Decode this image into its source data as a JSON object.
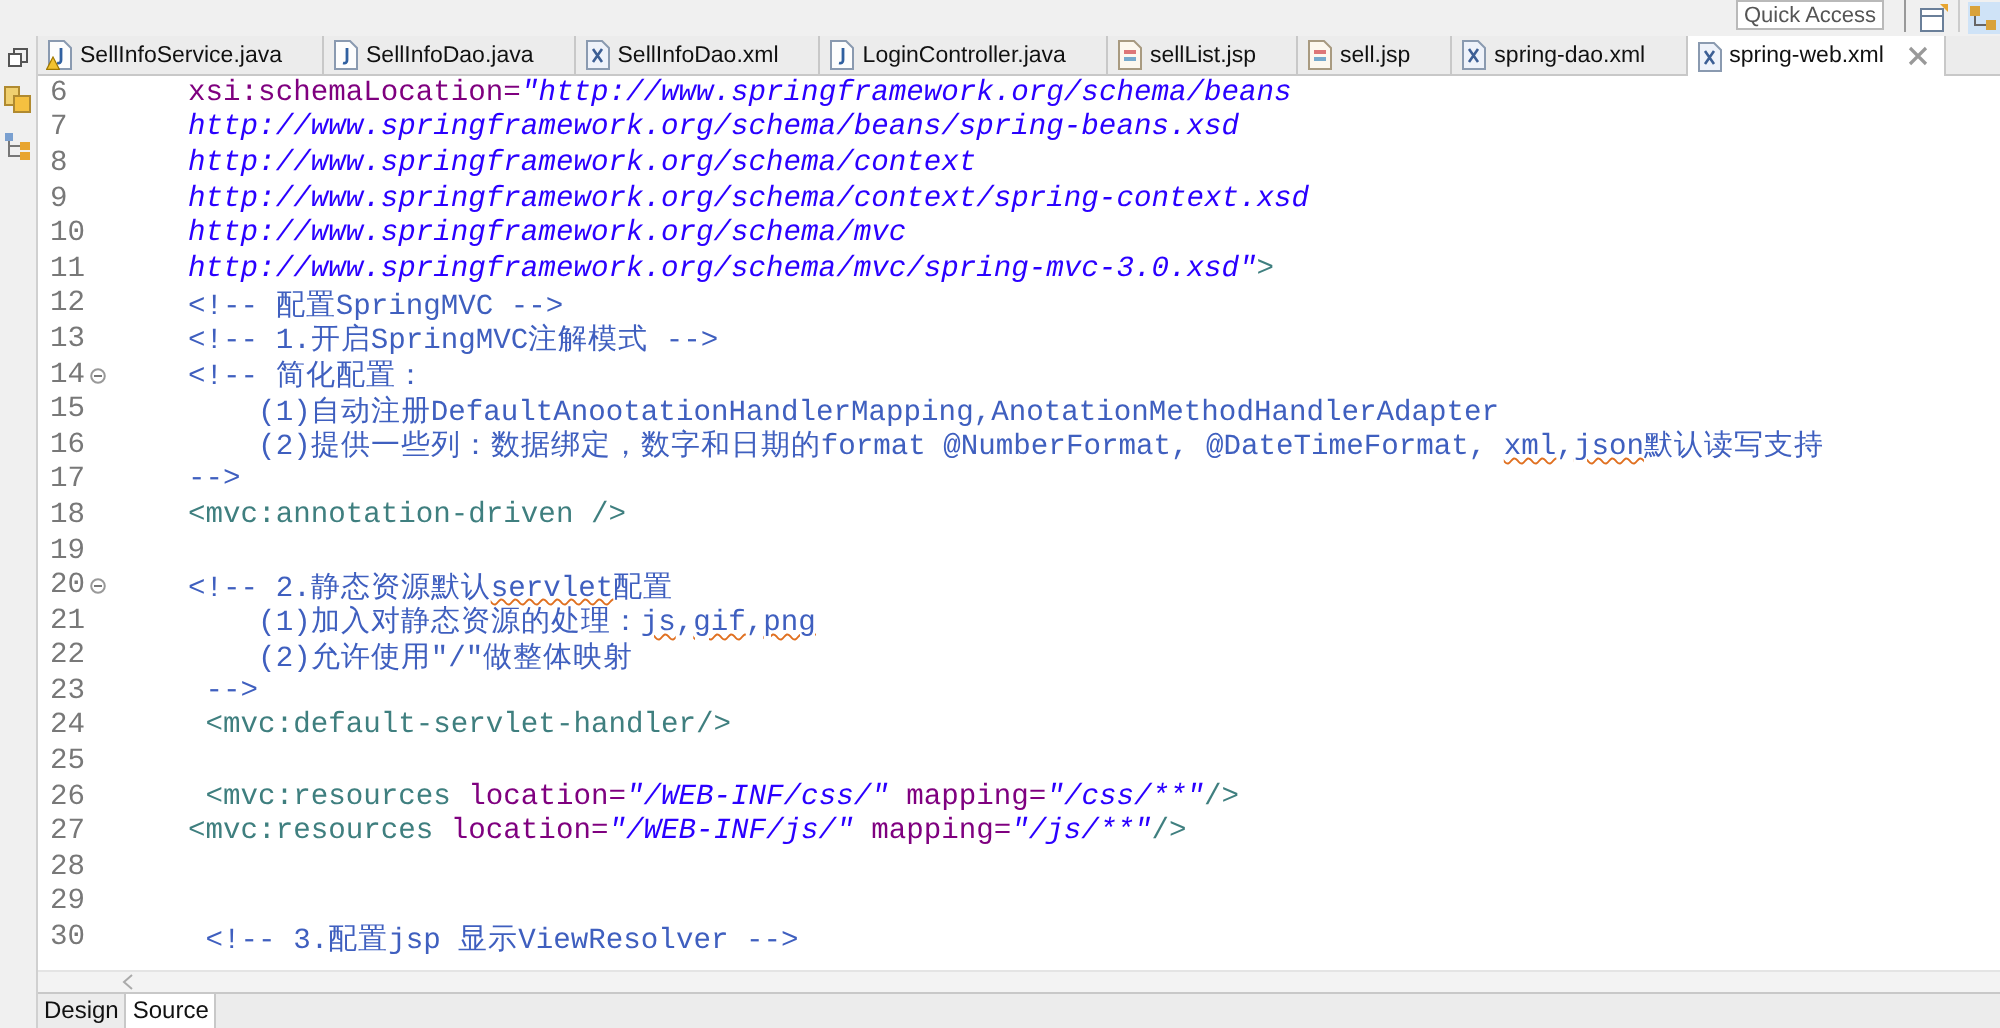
{
  "toolbar": {
    "quick_access": {
      "placeholder": "Quick Access"
    }
  },
  "tabs": [
    {
      "label": "SellInfoService.java",
      "kind": "java",
      "warning": true,
      "selected": false
    },
    {
      "label": "SellInfoDao.java",
      "kind": "java",
      "selected": false
    },
    {
      "label": "SellInfoDao.xml",
      "kind": "xml",
      "selected": false
    },
    {
      "label": "LoginController.java",
      "kind": "java",
      "selected": false
    },
    {
      "label": "sellList.jsp",
      "kind": "jsp",
      "selected": false
    },
    {
      "label": "sell.jsp",
      "kind": "jsp",
      "selected": false
    },
    {
      "label": "spring-dao.xml",
      "kind": "xml",
      "selected": false
    },
    {
      "label": "spring-web.xml",
      "kind": "xml",
      "selected": true
    }
  ],
  "editor": {
    "lines": [
      {
        "number": "6",
        "segments": [
          {
            "kind": "attr",
            "text": "    xsi:schemaLocation="
          },
          {
            "kind": "string",
            "text": "\"http://www.springframework.org/schema/beans"
          }
        ]
      },
      {
        "number": "7",
        "segments": [
          {
            "kind": "string",
            "text": "    http://www.springframework.org/schema/beans/spring-beans.xsd"
          }
        ]
      },
      {
        "number": "8",
        "segments": [
          {
            "kind": "string",
            "text": "    http://www.springframework.org/schema/context"
          }
        ]
      },
      {
        "number": "9",
        "segments": [
          {
            "kind": "string",
            "text": "    http://www.springframework.org/schema/context/spring-context.xsd"
          }
        ]
      },
      {
        "number": "10",
        "segments": [
          {
            "kind": "string",
            "text": "    http://www.springframework.org/schema/mvc"
          }
        ]
      },
      {
        "number": "11",
        "segments": [
          {
            "kind": "string",
            "text": "    http://www.springframework.org/schema/mvc/spring-mvc-3.0.xsd\""
          },
          {
            "kind": "tag",
            "text": ">"
          }
        ]
      },
      {
        "number": "12",
        "segments": [
          {
            "kind": "comment",
            "text": "    <!-- 配置SpringMVC -->"
          }
        ]
      },
      {
        "number": "13",
        "segments": [
          {
            "kind": "comment",
            "text": "    <!-- 1.开启SpringMVC注解模式 -->"
          }
        ]
      },
      {
        "number": "14",
        "fold_marker": true,
        "segments": [
          {
            "kind": "comment",
            "text": "    <!-- 简化配置："
          }
        ]
      },
      {
        "number": "15",
        "segments": [
          {
            "kind": "comment",
            "text": "        (1)自动注册DefaultAnootationHandlerMapping,AnotationMethodHandlerAdapter"
          }
        ]
      },
      {
        "number": "16",
        "segments": [
          {
            "kind": "comment",
            "text": "        (2)提供一些列：数据绑定，数字和日期的format @NumberFormat, @DateTimeFormat, "
          },
          {
            "kind": "comment-misspelled",
            "text": "xml"
          },
          {
            "kind": "comment",
            "text": ","
          },
          {
            "kind": "comment-misspelled",
            "text": "json"
          },
          {
            "kind": "comment",
            "text": "默认读写支持"
          }
        ]
      },
      {
        "number": "17",
        "segments": [
          {
            "kind": "comment",
            "text": "    -->"
          }
        ]
      },
      {
        "number": "18",
        "segments": [
          {
            "kind": "tag",
            "text": "    <mvc:annotation-driven />"
          }
        ]
      },
      {
        "number": "19"
      },
      {
        "number": "20",
        "fold_marker": true,
        "segments": [
          {
            "kind": "comment",
            "text": "    <!-- 2.静态资源默认"
          },
          {
            "kind": "comment-misspelled",
            "text": "servlet"
          },
          {
            "kind": "comment",
            "text": "配置"
          }
        ]
      },
      {
        "number": "21",
        "segments": [
          {
            "kind": "comment",
            "text": "        (1)加入对静态资源的处理："
          },
          {
            "kind": "comment-misspelled",
            "text": "js"
          },
          {
            "kind": "comment",
            "text": ","
          },
          {
            "kind": "comment-misspelled",
            "text": "gif"
          },
          {
            "kind": "comment",
            "text": ","
          },
          {
            "kind": "comment-misspelled",
            "text": "png"
          }
        ]
      },
      {
        "number": "22",
        "segments": [
          {
            "kind": "comment",
            "text": "        (2)允许使用\"/\"做整体映射"
          }
        ]
      },
      {
        "number": "23",
        "segments": [
          {
            "kind": "comment",
            "text": "     -->"
          }
        ]
      },
      {
        "number": "24",
        "segments": [
          {
            "kind": "tag",
            "text": "     <mvc:default-servlet-handler/>"
          }
        ]
      },
      {
        "number": "25"
      },
      {
        "number": "26",
        "segments": [
          {
            "kind": "tag",
            "text": "     <mvc:resources"
          },
          {
            "kind": "attr",
            "text": " location="
          },
          {
            "kind": "string",
            "text": "\"/WEB-INF/css/\""
          },
          {
            "kind": "attr",
            "text": " mapping="
          },
          {
            "kind": "string",
            "text": "\"/css/**\""
          },
          {
            "kind": "tag",
            "text": "/>"
          }
        ]
      },
      {
        "number": "27",
        "segments": [
          {
            "kind": "tag",
            "text": "    <mvc:resources"
          },
          {
            "kind": "attr",
            "text": " location="
          },
          {
            "kind": "string",
            "text": "\"/WEB-INF/js/\""
          },
          {
            "kind": "attr",
            "text": " mapping="
          },
          {
            "kind": "string",
            "text": "\"/js/**\""
          },
          {
            "kind": "tag",
            "text": "/>"
          }
        ]
      },
      {
        "number": "28"
      },
      {
        "number": "29"
      },
      {
        "number": "30",
        "segments": [
          {
            "kind": "comment",
            "text": "     <!-- 3.配置jsp 显示ViewResolver -->"
          }
        ]
      }
    ]
  },
  "bottom_tabs": [
    {
      "label": "Design",
      "selected": false
    },
    {
      "label": "Source",
      "selected": true
    }
  ]
}
